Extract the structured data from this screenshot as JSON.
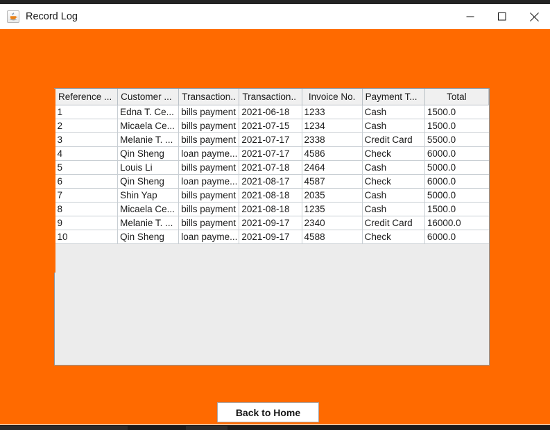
{
  "window": {
    "title": "Record Log",
    "icon": "java-coffee-cup-icon",
    "minimize_label": "—",
    "maximize_label": "☐",
    "close_label": "✕",
    "background_color": "#ff6a00"
  },
  "table": {
    "columns": [
      {
        "label": "Reference ...",
        "align": "left"
      },
      {
        "label": "Customer ...",
        "align": "left"
      },
      {
        "label": "Transaction..",
        "align": "left"
      },
      {
        "label": "Transaction..",
        "align": "left"
      },
      {
        "label": "Invoice No.",
        "align": "center"
      },
      {
        "label": "Payment T...",
        "align": "left"
      },
      {
        "label": "Total",
        "align": "center"
      }
    ],
    "rows": [
      [
        "1",
        "Edna T. Ce...",
        "bills payment",
        "2021-06-18",
        "1233",
        "Cash",
        "1500.0"
      ],
      [
        "2",
        "Micaela Ce...",
        "bills payment",
        "2021-07-15",
        "1234",
        "Cash",
        "1500.0"
      ],
      [
        "3",
        "Melanie T. ...",
        "bills payment",
        "2021-07-17",
        "2338",
        "Credit Card",
        "5500.0"
      ],
      [
        "4",
        "Qin Sheng",
        "loan payme...",
        "2021-07-17",
        "4586",
        "Check",
        "6000.0"
      ],
      [
        "5",
        "Louis Li",
        "bills payment",
        "2021-07-18",
        "2464",
        "Cash",
        "5000.0"
      ],
      [
        "6",
        "Qin Sheng",
        "loan payme...",
        "2021-08-17",
        "4587",
        "Check",
        "6000.0"
      ],
      [
        "7",
        "Shin Yap",
        "bills payment",
        "2021-08-18",
        "2035",
        "Cash",
        "5000.0"
      ],
      [
        "8",
        "Micaela Ce...",
        "bills payment",
        "2021-08-18",
        "1235",
        "Cash",
        "1500.0"
      ],
      [
        "9",
        "Melanie T. ...",
        "bills payment",
        "2021-09-17",
        "2340",
        "Credit Card",
        "16000.0"
      ],
      [
        "10",
        "Qin Sheng",
        "loan payme...",
        "2021-09-17",
        "4588",
        "Check",
        "6000.0"
      ]
    ]
  },
  "buttons": {
    "back_to_home": "Back to Home"
  }
}
